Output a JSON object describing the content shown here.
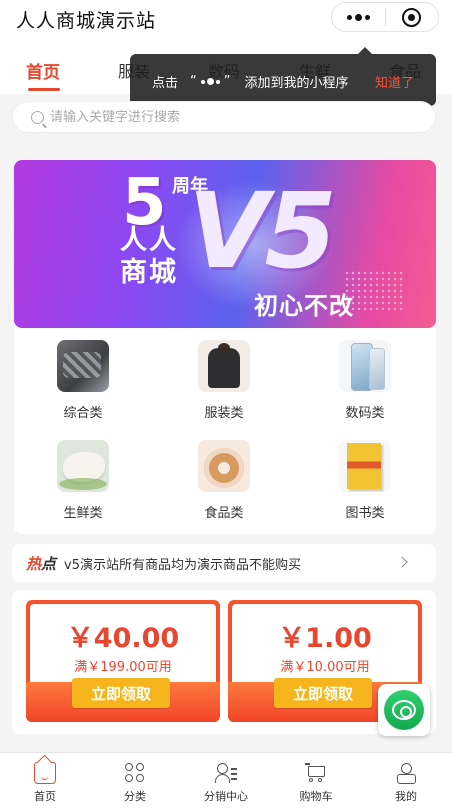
{
  "app": {
    "title": "人人商城演示站"
  },
  "capsule": {
    "more_icon": "more-dots-icon",
    "close_icon": "record-circle-icon"
  },
  "tabs": [
    {
      "label": "首页",
      "active": true
    },
    {
      "label": "服装"
    },
    {
      "label": "数码"
    },
    {
      "label": "生鲜"
    },
    {
      "label": "食品"
    }
  ],
  "tooltip": {
    "text_before": "点击",
    "quote_open": "“",
    "quote_close": "”",
    "text_after": "添加到我的小程序",
    "dismiss": "知道了"
  },
  "search": {
    "placeholder": "请输入关键字进行搜索"
  },
  "banner": {
    "number": "5",
    "zhou": "周年",
    "line1": "人人",
    "line2": "商城",
    "v5": "V5",
    "slogan": "初心不改"
  },
  "categories": [
    {
      "label": "综合类",
      "thumb": "zonghe"
    },
    {
      "label": "服装类",
      "thumb": "fuzhuang"
    },
    {
      "label": "数码类",
      "thumb": "shuma"
    },
    {
      "label": "生鲜类",
      "thumb": "shengxian"
    },
    {
      "label": "食品类",
      "thumb": "shipin"
    },
    {
      "label": "图书类",
      "thumb": "tushu"
    }
  ],
  "notice": {
    "hot_a": "热",
    "hot_b": "点",
    "text": "v5演示站所有商品均为演示商品不能购买"
  },
  "coupons": [
    {
      "amount": "￥40.00",
      "condition": "满￥199.00可用",
      "button": "立即领取"
    },
    {
      "amount": "￥1.00",
      "condition": "满￥10.00可用",
      "button": "立即领取"
    }
  ],
  "tabbar": [
    {
      "label": "首页",
      "icon": "home-icon",
      "active": true
    },
    {
      "label": "分类",
      "icon": "category-icon"
    },
    {
      "label": "分销中心",
      "icon": "distribution-icon"
    },
    {
      "label": "购物车",
      "icon": "cart-icon"
    },
    {
      "label": "我的",
      "icon": "user-icon"
    }
  ],
  "colors": {
    "accent": "#e8462e",
    "coupon_button": "#f6b51d",
    "service": "#1fbf5c"
  }
}
